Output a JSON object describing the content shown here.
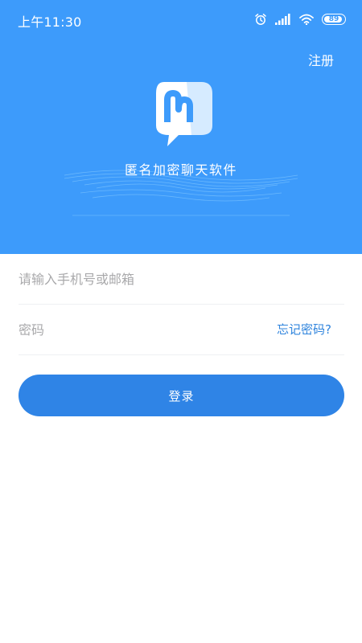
{
  "status_bar": {
    "time": "上午11:30",
    "battery_level": "89",
    "icons": [
      "alarm-icon",
      "signal-icon",
      "wifi-icon",
      "battery-icon"
    ]
  },
  "header": {
    "register_label": "注册",
    "app_name": "匿名加密聊天软件",
    "logo": "chat-bubble-logo"
  },
  "login_form": {
    "account_placeholder": "请输入手机号或邮箱",
    "password_placeholder": "密码",
    "forgot_password_label": "忘记密码?",
    "login_label": "登录"
  },
  "colors": {
    "header_background": "#3d9bfb",
    "accent": "#2f84e6",
    "link": "#2f84dd",
    "placeholder": "#a9a9ab"
  }
}
